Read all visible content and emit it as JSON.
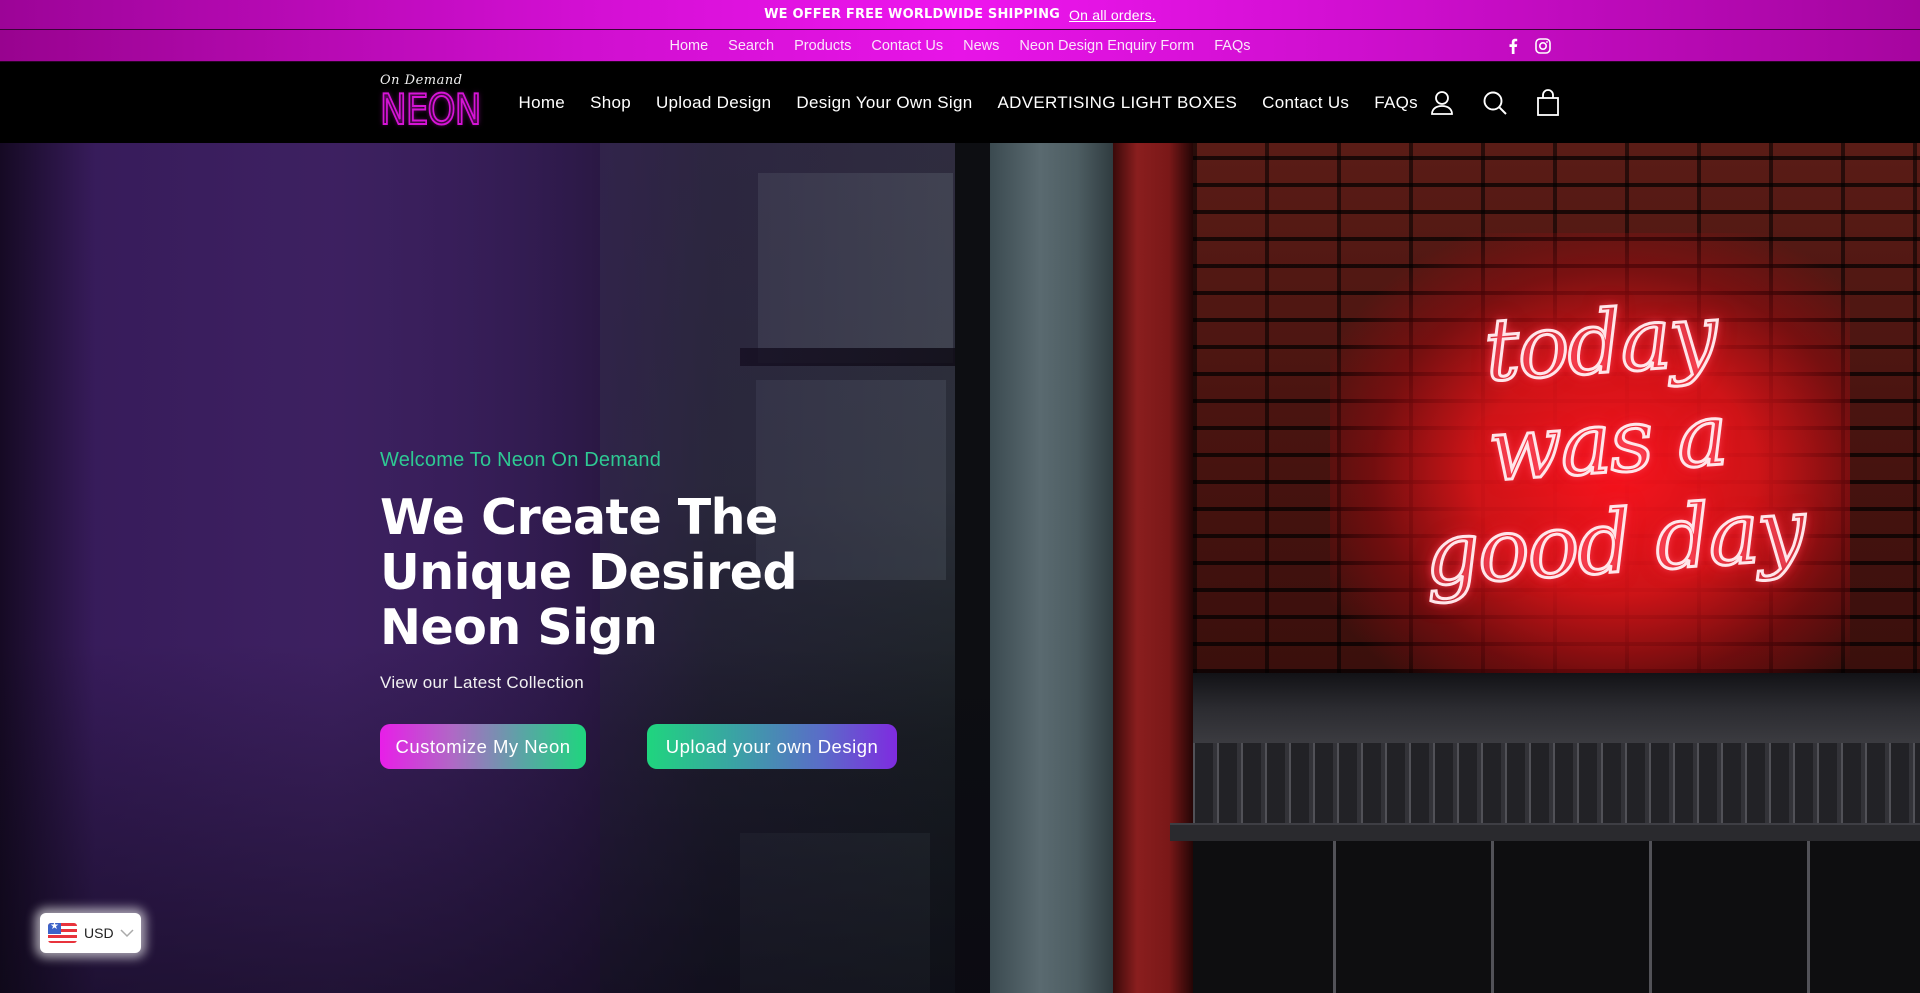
{
  "announcement": {
    "bold_text": "WE OFFER FREE WORLDWIDE SHIPPING",
    "link_text": "On all orders."
  },
  "utility_nav": {
    "links": [
      "Home",
      "Search",
      "Products",
      "Contact Us",
      "News",
      "Neon Design Enquiry Form",
      "FAQs"
    ],
    "social": [
      "facebook-icon",
      "instagram-icon"
    ]
  },
  "header": {
    "logo": {
      "script": "On Demand",
      "word": "NEON"
    },
    "nav": [
      "Home",
      "Shop",
      "Upload Design",
      "Design Your Own Sign",
      "ADVERTISING LIGHT BOXES",
      "Contact Us",
      "FAQs"
    ],
    "icons": [
      "account-icon",
      "search-icon",
      "cart-icon"
    ]
  },
  "hero": {
    "eyebrow": "Welcome To Neon On Demand",
    "headline_lines": [
      "We Create The",
      "Unique Desired",
      "Neon Sign"
    ],
    "subline": "View our Latest Collection",
    "buttons": [
      "Customize My Neon",
      "Upload your own Design"
    ],
    "neon_sign_lines": [
      "today",
      "was a",
      "good day"
    ]
  },
  "currency": {
    "code": "USD",
    "flag": "us-flag"
  },
  "colors": {
    "brand_magenta": "#e714e7",
    "accent_green": "#2ec993",
    "accent_purple": "#7f2be0"
  }
}
